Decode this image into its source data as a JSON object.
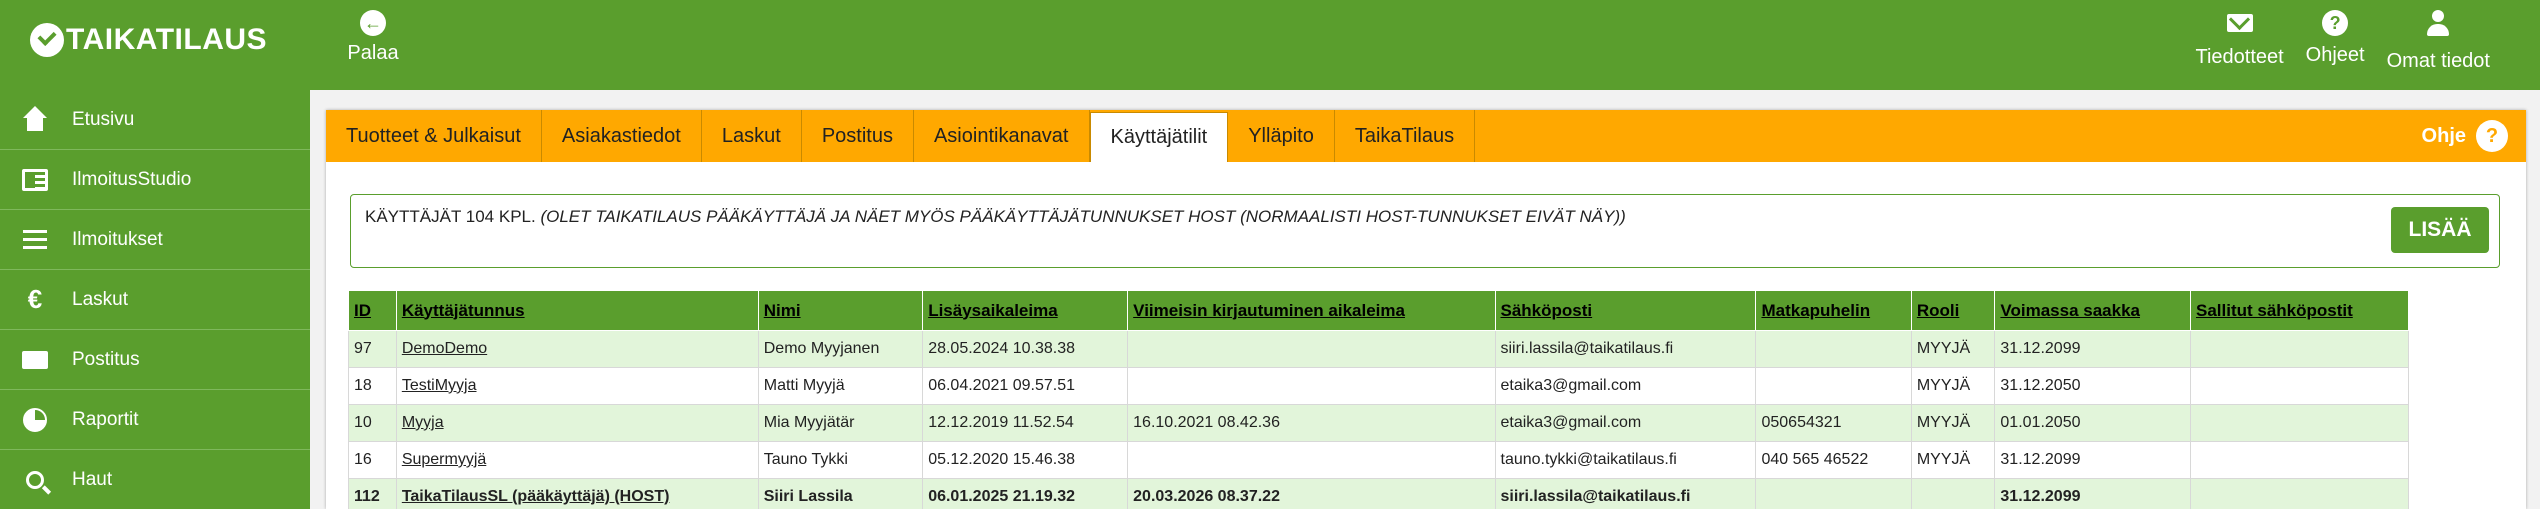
{
  "app": {
    "logo_text": "TAIKATILAUS"
  },
  "topbar": {
    "back_label": "Palaa",
    "actions": [
      {
        "label": "Tiedotteet",
        "icon": "envelope-icon"
      },
      {
        "label": "Ohjeet",
        "icon": "question-icon"
      },
      {
        "label": "Omat tiedot",
        "icon": "user-icon"
      }
    ]
  },
  "sidebar": {
    "items": [
      {
        "label": "Etusivu",
        "icon": "home-icon"
      },
      {
        "label": "IlmoitusStudio",
        "icon": "newspaper-icon"
      },
      {
        "label": "Ilmoitukset",
        "icon": "list-icon"
      },
      {
        "label": "Laskut",
        "icon": "euro-icon"
      },
      {
        "label": "Postitus",
        "icon": "envelope-icon"
      },
      {
        "label": "Raportit",
        "icon": "pie-chart-icon"
      },
      {
        "label": "Haut",
        "icon": "search-icon"
      }
    ]
  },
  "tabs": [
    "Tuotteet & Julkaisut",
    "Asiakastiedot",
    "Laskut",
    "Postitus",
    "Asiointikanavat",
    "Käyttäjätilit",
    "Ylläpito",
    "TaikaTilaus"
  ],
  "active_tab": "Käyttäjätilit",
  "help_label": "Ohje",
  "info": {
    "count_text": "KÄYTTÄJÄT 104 KPL.",
    "note_text": "(OLET TAIKATILAUS PÄÄKÄYTTÄJÄ JA NÄET MYÖS PÄÄKÄYTTÄJÄTUNNUKSET HOST (NORMAALISTI HOST-TUNNUKSET EIVÄT NÄY))",
    "add_label": "LISÄÄ"
  },
  "table": {
    "headers": [
      "ID",
      "Käyttäjätunnus",
      "Nimi",
      "Lisäysaikaleima",
      "Viimeisin kirjautuminen aikaleima",
      "Sähköposti",
      "Matkapuhelin",
      "Rooli",
      "Voimassa saakka",
      "Sallitut sähköpostit"
    ],
    "rows": [
      [
        "97",
        "DemoDemo",
        "Demo Myyjanen",
        "28.05.2024 10.38.38",
        "",
        "siiri.lassila@taikatilaus.fi",
        "",
        "MYYJÄ",
        "31.12.2099",
        ""
      ],
      [
        "18",
        "TestiMyyja",
        "Matti Myyjä",
        "06.04.2021 09.57.51",
        "",
        "etaika3@gmail.com",
        "",
        "MYYJÄ",
        "31.12.2050",
        ""
      ],
      [
        "10",
        "Myyja",
        "Mia Myyjätär",
        "12.12.2019 11.52.54",
        "16.10.2021 08.42.36",
        "etaika3@gmail.com",
        "050654321",
        "MYYJÄ",
        "01.01.2050",
        ""
      ],
      [
        "16",
        "Supermyyjä",
        "Tauno Tykki",
        "05.12.2020 15.46.38",
        "",
        "tauno.tykki@taikatilaus.fi",
        "040 565 46522",
        "MYYJÄ",
        "31.12.2099",
        ""
      ],
      [
        "112",
        "TaikaTilausSL (pääkäyttäjä) (HOST)",
        "Siiri Lassila",
        "06.01.2025 21.19.32",
        "20.03.2026 08.37.22",
        "siiri.lassila@taikatilaus.fi",
        "",
        "",
        "31.12.2099",
        ""
      ]
    ]
  },
  "colors": {
    "brand_green": "#5a9e2d",
    "tab_orange": "#ffa800",
    "row_light_green": "#e2f5da",
    "valid_date_green": "#2f8a1a"
  }
}
